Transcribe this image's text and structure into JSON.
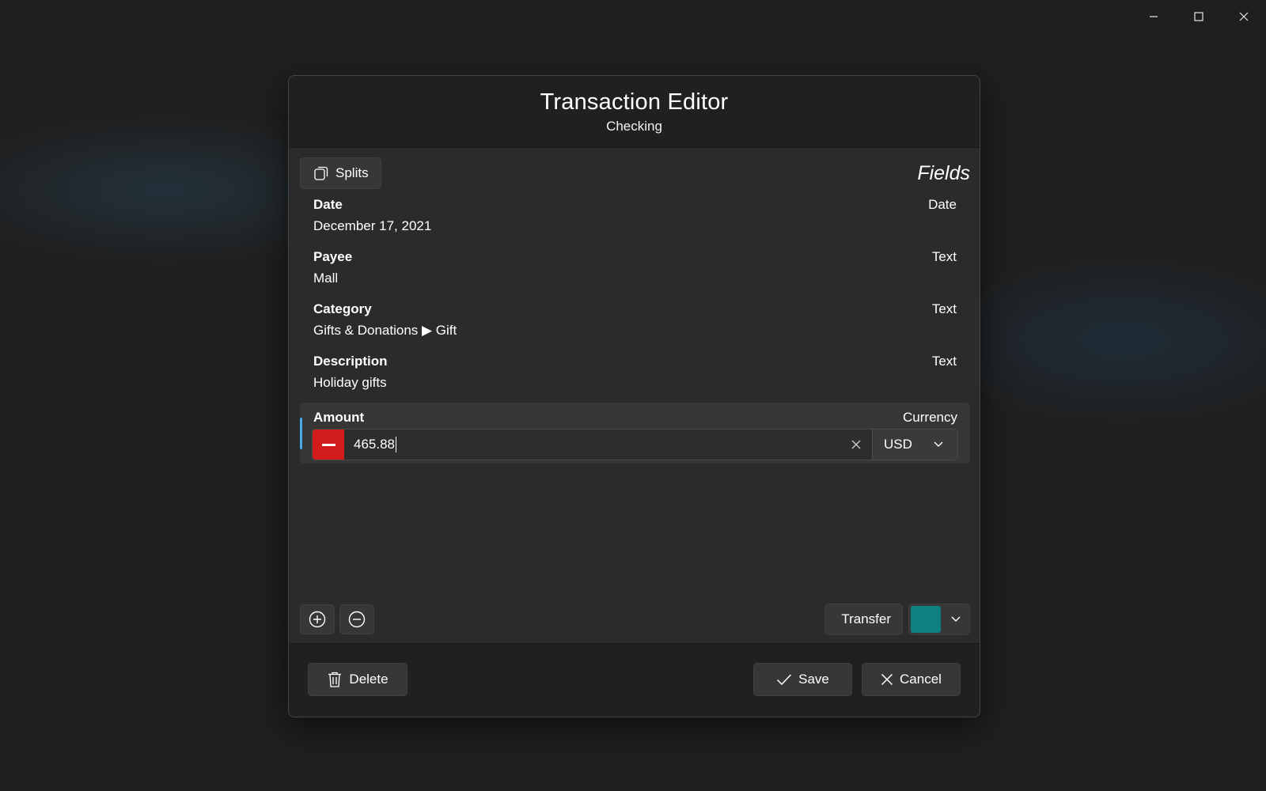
{
  "window": {
    "controls": [
      "minimize-icon",
      "maximize-icon",
      "close-icon"
    ]
  },
  "dialog": {
    "title": "Transaction Editor",
    "subtitle": "Checking",
    "splits_label": "Splits",
    "fields_heading": "Fields",
    "fields": [
      {
        "label": "Date",
        "value": "December 17, 2021",
        "type": "Date"
      },
      {
        "label": "Payee",
        "value": "Mall",
        "type": "Text"
      },
      {
        "label": "Category",
        "value": "Gifts & Donations ▶ Gift",
        "type": "Text"
      },
      {
        "label": "Description",
        "value": "Holiday gifts",
        "type": "Text"
      }
    ],
    "amount": {
      "label": "Amount",
      "type": "Currency",
      "value": "465.88",
      "sign": "minus",
      "currency": "USD",
      "sign_color": "#d21c1c"
    },
    "transfer_label": "Transfer",
    "color_swatch": "#0e8080",
    "buttons": {
      "delete": "Delete",
      "save": "Save",
      "cancel": "Cancel"
    }
  }
}
